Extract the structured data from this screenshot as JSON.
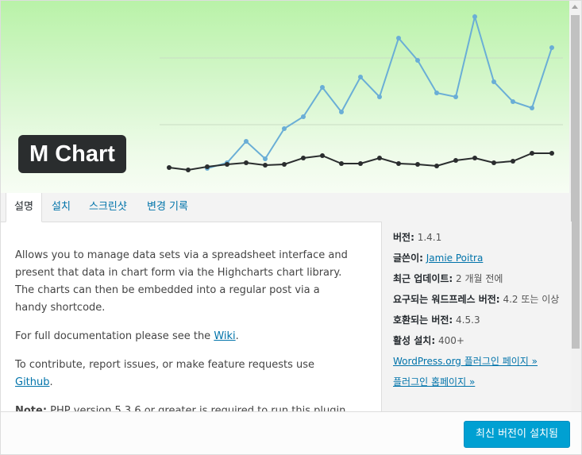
{
  "plugin": {
    "title": "M Chart"
  },
  "tabs": [
    {
      "label": "설명"
    },
    {
      "label": "설치"
    },
    {
      "label": "스크린샷"
    },
    {
      "label": "변경 기록"
    }
  ],
  "description": {
    "p1": "Allows you to manage data sets via a spreadsheet interface and present that data in chart form via the Highcharts chart library. The charts can then be embedded into a regular post via a handy shortcode.",
    "p2_before": "For full documentation please see the ",
    "p2_link": "Wiki",
    "p2_after": ".",
    "p3_before": "To contribute, report issues, or make feature requests use ",
    "p3_link": "Github",
    "p3_after": ".",
    "p4_label": "Note:",
    "p4_text": " PHP version 5.3.6 or greater is required to run this plugin."
  },
  "meta": {
    "version_label": "버전:",
    "version_value": "1.4.1",
    "author_label": "글쓴이:",
    "author_value": "Jamie Poitra",
    "updated_label": "최근 업데이트:",
    "updated_value": "2 개월 전에",
    "requires_label": "요구되는 워드프레스 버전:",
    "requires_value": "4.2 또는 이상",
    "compatible_label": "호환되는 버전:",
    "compatible_value": "4.5.3",
    "installs_label": "활성 설치:",
    "installs_value": "400+",
    "wporg_link": "WordPress.org 플러그인 페이지 »",
    "homepage_link": "플러그인 홈페이지 »"
  },
  "footer": {
    "install_button": "최신 버전이 설치됨"
  },
  "colors": {
    "accent": "#00a0d2",
    "link": "#0073aa"
  }
}
